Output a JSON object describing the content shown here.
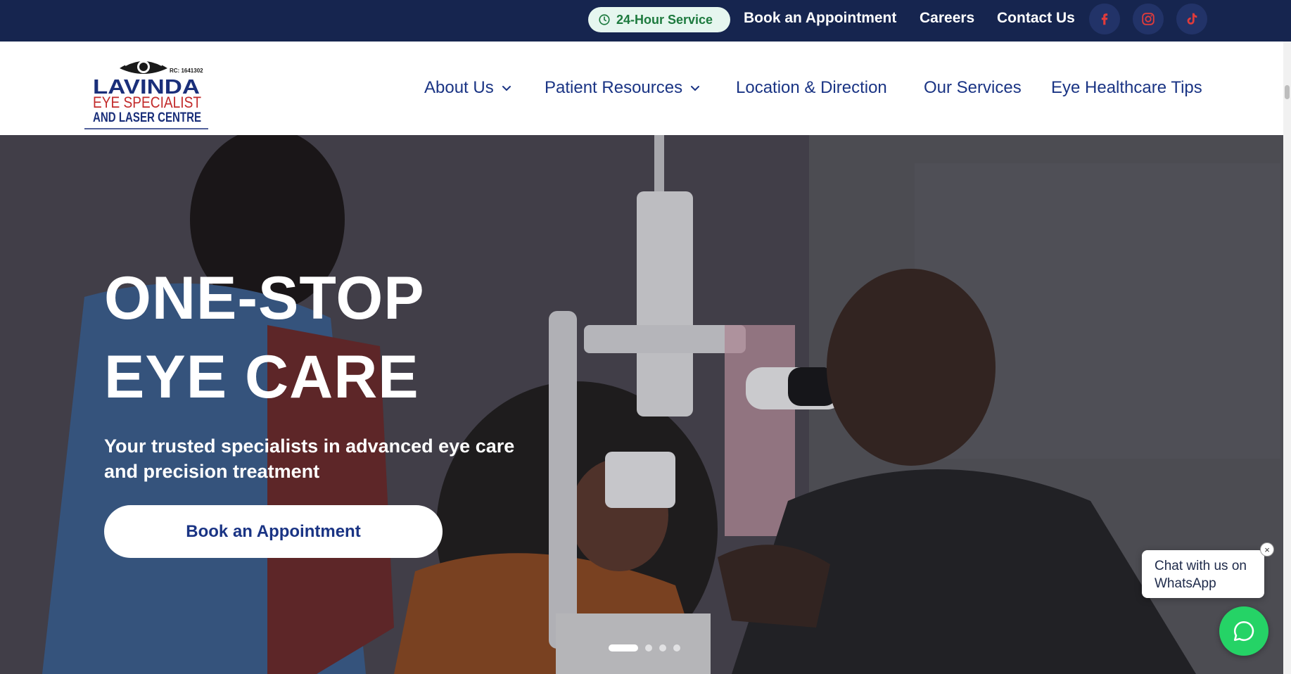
{
  "topbar": {
    "service_badge": "24-Hour Service",
    "links": [
      "Book an Appointment",
      "Careers",
      "Contact Us"
    ],
    "socials": [
      "facebook-icon",
      "instagram-icon",
      "tiktok-icon"
    ]
  },
  "logo": {
    "rc": "RC: 1641302",
    "line1": "LAVINDA",
    "line2": "EYE SPECIALIST",
    "line3": "AND LASER CENTRE"
  },
  "nav": {
    "items": [
      "About Us",
      "Patient Resources",
      "Location & Direction",
      "Our Services",
      "Eye Healthcare Tips"
    ]
  },
  "hero": {
    "title_line1": "ONE-STOP",
    "title_line2": "EYE CARE",
    "subtitle": "Your trusted specialists in advanced eye care and precision treatment",
    "cta": "Book an Appointment",
    "slide_count": 4,
    "active_slide": 1
  },
  "whatsapp": {
    "bubble_text": "Chat with us on WhatsApp",
    "close": "×"
  },
  "colors": {
    "topbar": "#16254f",
    "brand_blue": "#1a3484",
    "whatsapp_green": "#25d366",
    "badge_green": "#1d7a3e",
    "social_red": "#e03b3b"
  }
}
